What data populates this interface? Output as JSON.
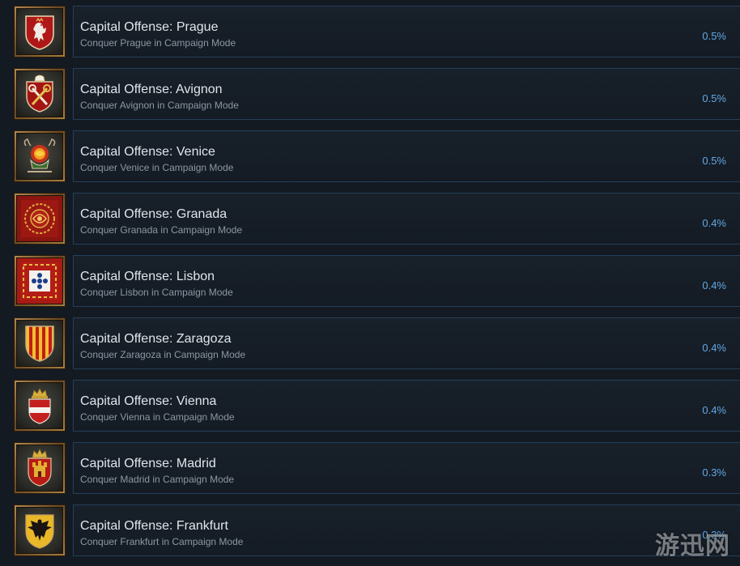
{
  "achievements": [
    {
      "title": "Capital Offense: Prague",
      "description": "Conquer Prague in Campaign Mode",
      "percent": "0.5%",
      "icon": "prague-lion-shield-icon"
    },
    {
      "title": "Capital Offense: Avignon",
      "description": "Conquer Avignon in Campaign Mode",
      "percent": "0.5%",
      "icon": "avignon-papal-keys-shield-icon"
    },
    {
      "title": "Capital Offense: Venice",
      "description": "Conquer Venice in Campaign Mode",
      "percent": "0.5%",
      "icon": "venice-lion-crest-icon"
    },
    {
      "title": "Capital Offense: Granada",
      "description": "Conquer Granada in Campaign Mode",
      "percent": "0.4%",
      "icon": "granada-ornate-emblem-icon"
    },
    {
      "title": "Capital Offense: Lisbon",
      "description": "Conquer Lisbon in Campaign Mode",
      "percent": "0.4%",
      "icon": "lisbon-quinas-emblem-icon"
    },
    {
      "title": "Capital Offense: Zaragoza",
      "description": "Conquer Zaragoza in Campaign Mode",
      "percent": "0.4%",
      "icon": "zaragoza-striped-shield-icon"
    },
    {
      "title": "Capital Offense: Vienna",
      "description": "Conquer Vienna in Campaign Mode",
      "percent": "0.4%",
      "icon": "vienna-crowned-shield-icon"
    },
    {
      "title": "Capital Offense: Madrid",
      "description": "Conquer Madrid in Campaign Mode",
      "percent": "0.3%",
      "icon": "madrid-castle-shield-icon"
    },
    {
      "title": "Capital Offense: Frankfurt",
      "description": "Conquer Frankfurt in Campaign Mode",
      "percent": "0.3%",
      "icon": "frankfurt-eagle-shield-icon"
    }
  ],
  "watermark": "游迅网",
  "colors": {
    "background": "#141a22",
    "panel_border": "#24405a",
    "title": "#e1e6eb",
    "description": "#8c97a3",
    "percent": "#62a8e4",
    "icon_frame": "#a7803f"
  }
}
